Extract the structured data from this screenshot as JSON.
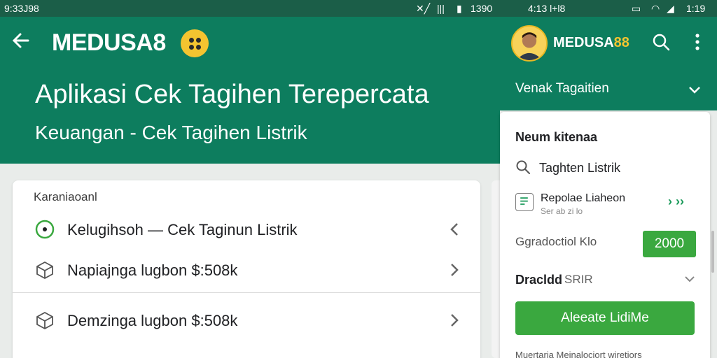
{
  "status_left": {
    "time": "9:33J98"
  },
  "status_mid": {
    "text": "1390"
  },
  "status_right": {
    "time": "4:13 l+l8",
    "battery": "1:19"
  },
  "header": {
    "brand": "MEDUSA8",
    "title": "Aplikasi Cek Tagihen Terepercata",
    "subtitle": "Keuangan - Cek Tagihen Listrik"
  },
  "card": {
    "label": "Karaniaoanl",
    "rows": [
      {
        "text": "Kelugihsoh — Cek Taginun Listrik",
        "icon": "radio-dot-icon",
        "chevron": "chevron-left-icon"
      },
      {
        "text": "Napiajnga lugbon $:508k",
        "icon": "box-icon",
        "chevron": "chevron-right-icon"
      },
      {
        "text": "Demzinga lugbon $:508k",
        "icon": "box-icon",
        "chevron": "chevron-right-icon"
      }
    ]
  },
  "right": {
    "brand_plain": "MEDUSA",
    "brand_accent": "88",
    "select_label": "Venak Tagaitien",
    "panel": {
      "title": "Neum kitenaa",
      "search_text": "Taghten Listrik",
      "item_title": "Repolae Liaheon",
      "item_sub": "Ser ab zi lo",
      "item_arrows": "› ››",
      "amount_label": "Ggradoctiol Klo",
      "amount_value": "2000",
      "dropdown_label": "Dracldd",
      "dropdown_value": "SRIR",
      "button_label": "Aleeate LidiMe",
      "footer": "Muertaria Meinalociort wiretiors"
    }
  },
  "colors": {
    "primary": "#0d7d5e",
    "accent_green": "#3aa83f",
    "brand_yellow": "#f4c430"
  }
}
